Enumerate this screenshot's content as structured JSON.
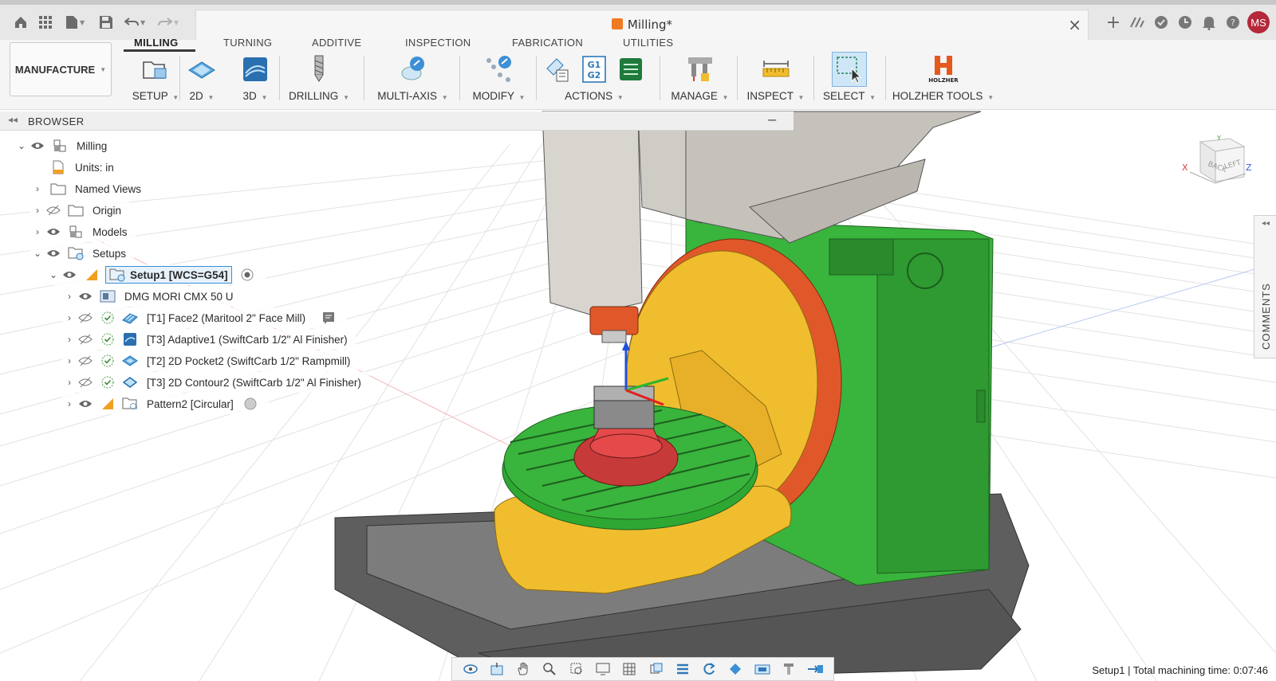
{
  "app": {
    "doc_title": "Milling*",
    "avatar_initials": "MS"
  },
  "workspace": {
    "label": "MANUFACTURE"
  },
  "tabs": [
    "MILLING",
    "TURNING",
    "ADDITIVE",
    "INSPECTION",
    "FABRICATION",
    "UTILITIES"
  ],
  "groups": {
    "setup": "SETUP",
    "g2d": "2D",
    "g3d": "3D",
    "drilling": "DRILLING",
    "multiaxis": "MULTI-AXIS",
    "modify": "MODIFY",
    "actions": "ACTIONS",
    "manage": "MANAGE",
    "inspect": "INSPECT",
    "select": "SELECT",
    "holzher": "HOLZHER TOOLS",
    "holzher_logo": "HOLZHER",
    "g1g2": "G1\nG2"
  },
  "browser": {
    "title": "BROWSER",
    "items": [
      {
        "label": "Milling"
      },
      {
        "label": "Units: in"
      },
      {
        "label": "Named Views"
      },
      {
        "label": "Origin"
      },
      {
        "label": "Models"
      },
      {
        "label": "Setups"
      },
      {
        "label": "Setup1 [WCS=G54]"
      },
      {
        "label": "DMG MORI CMX 50 U"
      },
      {
        "label": "[T1] Face2 (Maritool 2\" Face Mill)"
      },
      {
        "label": "[T3] Adaptive1 (SwiftCarb 1/2\" Al Finisher)"
      },
      {
        "label": "[T2] 2D Pocket2 (SwiftCarb 1/2\" Rampmill)"
      },
      {
        "label": "[T3] 2D Contour2 (SwiftCarb 1/2\" Al Finisher)"
      },
      {
        "label": "Pattern2 [Circular]"
      }
    ]
  },
  "viewcube": {
    "back": "BACK",
    "left": "LEFT",
    "x": "X",
    "y": "Y",
    "z": "Z"
  },
  "comments": {
    "label": "COMMENTS"
  },
  "status": {
    "text": "Setup1 | Total machining time: 0:07:46"
  },
  "colors": {
    "machine_green": "#39b43c",
    "rotary_yellow": "#f0bd2e",
    "rotary_orange": "#e0582a",
    "chuck_red": "#e44a4a",
    "avatar": "#b5283a",
    "doc_icon": "#f07a22"
  }
}
